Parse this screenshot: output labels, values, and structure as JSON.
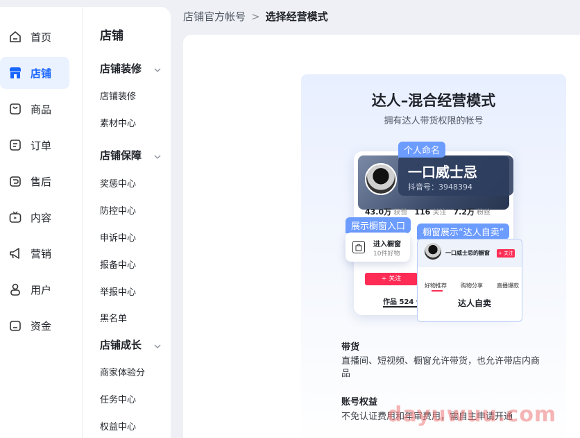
{
  "nav": {
    "items": [
      {
        "label": "首页",
        "icon": "home-icon"
      },
      {
        "label": "店铺",
        "icon": "store-icon",
        "active": true
      },
      {
        "label": "商品",
        "icon": "bag-icon"
      },
      {
        "label": "订单",
        "icon": "order-icon"
      },
      {
        "label": "售后",
        "icon": "after-sale-icon"
      },
      {
        "label": "内容",
        "icon": "tv-icon"
      },
      {
        "label": "营销",
        "icon": "megaphone-icon"
      },
      {
        "label": "用户",
        "icon": "user-icon"
      },
      {
        "label": "资金",
        "icon": "wallet-icon"
      }
    ]
  },
  "sidebar": {
    "title": "店铺",
    "groups": [
      {
        "label": "店铺装修",
        "items": [
          "店铺装修",
          "素材中心"
        ]
      },
      {
        "label": "店铺保障",
        "items": [
          "奖惩中心",
          "防控中心",
          "申诉中心",
          "报备中心",
          "举报中心",
          "黑名单"
        ]
      },
      {
        "label": "店铺成长",
        "items": [
          "商家体验分",
          "任务中心",
          "权益中心"
        ]
      }
    ]
  },
  "breadcrumb": {
    "parent": "店铺官方帐号",
    "separator": ">",
    "current": "选择经营模式"
  },
  "card": {
    "title": "达人–混合经营模式",
    "subtitle": "拥有达人带货权限的帐号",
    "preview": {
      "tag_name": "个人命名",
      "name": "一口威士忌",
      "douyin_id": "抖音号：3948394",
      "stats": [
        {
          "value": "43.0万",
          "label": "获赞"
        },
        {
          "value": "116",
          "label": "关注"
        },
        {
          "value": "7.2万",
          "label": "粉丝"
        }
      ],
      "tag_entry": "展示橱窗入口",
      "entry_title": "进入橱窗",
      "entry_sub": "10件好物",
      "follow_label": "+ 关注",
      "works": "作品 524 ▾",
      "tag_showcase": "橱窗展示“达人自卖”",
      "shop_name": "一口威士忌的橱窗",
      "shop_follow": "+ 关注",
      "shop_tabs": [
        "好物推荐",
        "购物分享",
        "直播爆款"
      ],
      "shop_label": "达人自卖"
    },
    "sections": [
      {
        "heading": "带货",
        "text": "直播间、短视频、橱窗允许带货，也允许带店内商品"
      },
      {
        "heading": "账号权益",
        "text": "不免认证费用和年审费用，需自主申请开通"
      }
    ]
  },
  "watermark": "dayuwuu.com",
  "colors": {
    "accent": "#1966ff",
    "tag": "#6d9cff",
    "douyin_red": "#fe2c55"
  }
}
